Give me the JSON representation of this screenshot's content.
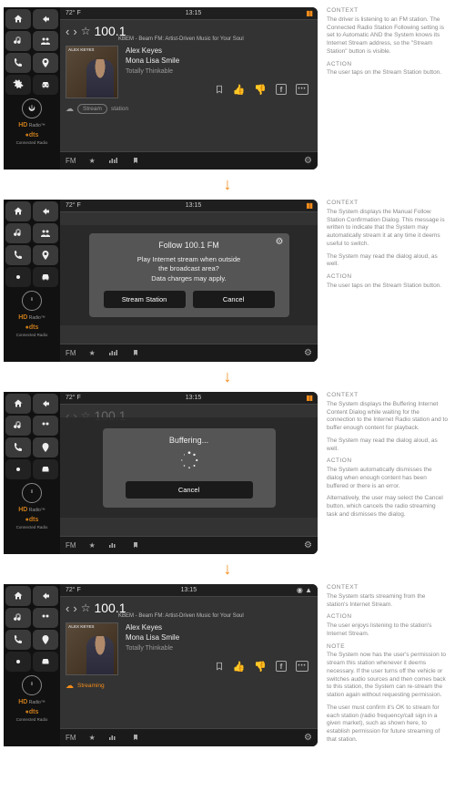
{
  "status": {
    "temp": "72° F",
    "time": "13:15"
  },
  "station": {
    "frequency": "100.1",
    "subtitle": "KBEM - Beam FM: Artist-Driven Music for Your Soul"
  },
  "track": {
    "artist": "Alex Keyes",
    "title": "Mona Lisa Smile",
    "album": "Totally Thinkable"
  },
  "stream": {
    "label_word": "Stream",
    "label_rest": "station",
    "streaming_label": "Streaming"
  },
  "bottom": {
    "fm": "FM"
  },
  "logos": {
    "hd": "HD",
    "radio": "Radio",
    "dts": "dts",
    "connected": "Connected Radio"
  },
  "dialog_follow": {
    "title": "Follow 100.1 FM",
    "line1": "Play Internet stream when outside",
    "line2": "the broadcast area?",
    "line3": "Data charges may apply.",
    "btn_stream": "Stream Station",
    "btn_cancel": "Cancel"
  },
  "dialog_buffer": {
    "title": "Buffering...",
    "btn_cancel": "Cancel"
  },
  "annotations": {
    "s1": {
      "h_context": "CONTEXT",
      "context": "The driver is listening to an FM station. The Connected Radio Station Following setting is set to Automatic AND the System knows its Internet Stream address, so the \"Stream Station\" button is visible.",
      "h_action": "ACTION",
      "action": "The user taps on the Stream Station button."
    },
    "s2": {
      "h_context": "CONTEXT",
      "context1": "The System displays the Manual Follow Station Confirmation Dialog. This message is written to indicate that the System may automatically stream it at any time it deems useful to switch.",
      "context2": "The System may read the dialog aloud, as well.",
      "h_action": "ACTION",
      "action": "The user taps on the Stream Station button."
    },
    "s3": {
      "h_context": "CONTEXT",
      "context1": "The System displays the Buffering Internet Content Dialog while waiting for the connection to the Internet Radio station and to buffer enough content for playback.",
      "context2": "The System may read the dialog aloud, as well.",
      "h_action": "ACTION",
      "action1": "The System automatically dismisses the dialog when enough content has been buffered or there is an error.",
      "action2": "Alternatively, the user may select the Cancel button, which cancels the radio streaming task and dismisses the dialog."
    },
    "s4": {
      "h_context": "CONTEXT",
      "context": "The System starts streaming from the station's Internet Stream.",
      "h_action": "ACTION",
      "action": "The user enjoys listening to the station's Internet Stream.",
      "h_note": "NOTE",
      "note1": "The System now has the user's permission to stream this station whenever it deems necessary. If the user turns off the vehicle or switches audio sources and then comes back to this station, the System can re-stream the station again without requesting permission.",
      "note2": "The user must confirm it's OK to stream for each station (radio frequency/call sign in a given market), such as shown here, to establish permission for future streaming of that station."
    }
  },
  "arrow": "↓"
}
